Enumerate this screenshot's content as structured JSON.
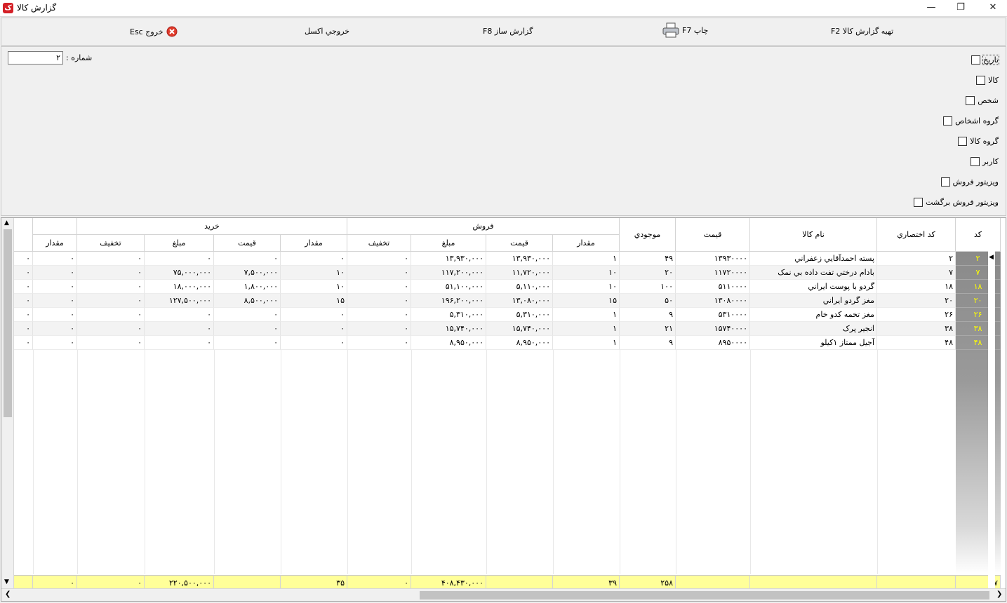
{
  "window": {
    "title": "گزارش کالا",
    "icon": "app-logo-icon",
    "app_letter": "ک"
  },
  "toolbar": {
    "prepare": "تهیه گزارش کالا F2",
    "print": "چاپ F7",
    "report_builder": "گزارش ساز F8",
    "excel": "خروجي اکسل",
    "exit": "خروج Esc"
  },
  "filters": {
    "items": [
      "تاریخ",
      "کالا",
      "شخص",
      "گروه اشخاص",
      "گروه کالا",
      "کاربر",
      "ویزیتور فروش",
      "ویزیتور فروش برگشت"
    ],
    "number_label": "شماره :",
    "number_value": "۲"
  },
  "grid": {
    "headers": {
      "code": "کد",
      "short_code": "کد اختصاري",
      "name": "نام کالا",
      "price": "قيمت",
      "stock": "موجودي",
      "sales": "فروش",
      "purchase": "خريد",
      "qty": "مقدار",
      "unit_price": "قيمت",
      "amount": "مبلغ",
      "discount": "تخفیف"
    },
    "rows": [
      {
        "code": "۲",
        "short": "۲",
        "name": "پسته احمدآقايي زعفراني",
        "price": "۱۳۹۳۰۰۰۰",
        "stock": "۴۹",
        "s_qty": "۱",
        "s_price": "۱۳,۹۳۰,۰۰۰",
        "s_amount": "۱۳,۹۳۰,۰۰۰",
        "s_disc": "۰",
        "p_qty": "۰",
        "p_price": "۰",
        "p_amount": "۰",
        "p_disc": "۰",
        "r_qty": "۰",
        "r_x": "۰"
      },
      {
        "code": "۷",
        "short": "۷",
        "name": "بادام درختي تفت داده بي نمک",
        "price": "۱۱۷۲۰۰۰۰",
        "stock": "۲۰",
        "s_qty": "۱۰",
        "s_price": "۱۱,۷۲۰,۰۰۰",
        "s_amount": "۱۱۷,۲۰۰,۰۰۰",
        "s_disc": "۰",
        "p_qty": "۱۰",
        "p_price": "۷,۵۰۰,۰۰۰",
        "p_amount": "۷۵,۰۰۰,۰۰۰",
        "p_disc": "۰",
        "r_qty": "۰",
        "r_x": "۰"
      },
      {
        "code": "۱۸",
        "short": "۱۸",
        "name": "گردو با پوست ايراني",
        "price": "۵۱۱۰۰۰۰",
        "stock": "۱۰۰",
        "s_qty": "۱۰",
        "s_price": "۵,۱۱۰,۰۰۰",
        "s_amount": "۵۱,۱۰۰,۰۰۰",
        "s_disc": "۰",
        "p_qty": "۱۰",
        "p_price": "۱,۸۰۰,۰۰۰",
        "p_amount": "۱۸,۰۰۰,۰۰۰",
        "p_disc": "۰",
        "r_qty": "۰",
        "r_x": "۰"
      },
      {
        "code": "۲۰",
        "short": "۲۰",
        "name": "مغز گردو ايراني",
        "price": "۱۳۰۸۰۰۰۰",
        "stock": "۵۰",
        "s_qty": "۱۵",
        "s_price": "۱۳,۰۸۰,۰۰۰",
        "s_amount": "۱۹۶,۲۰۰,۰۰۰",
        "s_disc": "۰",
        "p_qty": "۱۵",
        "p_price": "۸,۵۰۰,۰۰۰",
        "p_amount": "۱۲۷,۵۰۰,۰۰۰",
        "p_disc": "۰",
        "r_qty": "۰",
        "r_x": "۰"
      },
      {
        "code": "۲۶",
        "short": "۲۶",
        "name": "مغز تخمه کدو خام",
        "price": "۵۳۱۰۰۰۰",
        "stock": "۹",
        "s_qty": "۱",
        "s_price": "۵,۳۱۰,۰۰۰",
        "s_amount": "۵,۳۱۰,۰۰۰",
        "s_disc": "۰",
        "p_qty": "۰",
        "p_price": "۰",
        "p_amount": "۰",
        "p_disc": "۰",
        "r_qty": "۰",
        "r_x": "۰"
      },
      {
        "code": "۳۸",
        "short": "۳۸",
        "name": "انجير پرک",
        "price": "۱۵۷۴۰۰۰۰",
        "stock": "۲۱",
        "s_qty": "۱",
        "s_price": "۱۵,۷۴۰,۰۰۰",
        "s_amount": "۱۵,۷۴۰,۰۰۰",
        "s_disc": "۰",
        "p_qty": "۰",
        "p_price": "۰",
        "p_amount": "۰",
        "p_disc": "۰",
        "r_qty": "۰",
        "r_x": "۰"
      },
      {
        "code": "۴۸",
        "short": "۴۸",
        "name": "آجیل ممتاز ۱کیلو",
        "price": "۸۹۵۰۰۰۰",
        "stock": "۹",
        "s_qty": "۱",
        "s_price": "۸,۹۵۰,۰۰۰",
        "s_amount": "۸,۹۵۰,۰۰۰",
        "s_disc": "۰",
        "p_qty": "۰",
        "p_price": "۰",
        "p_amount": "۰",
        "p_disc": "۰",
        "r_qty": "۰",
        "r_x": "۰"
      }
    ],
    "footer": {
      "code": "۷",
      "stock": "۲۵۸",
      "s_qty": "۳۹",
      "s_amount": "۴۰۸,۴۳۰,۰۰۰",
      "s_disc": "۰",
      "p_qty": "۳۵",
      "p_amount": "۲۲۰,۵۰۰,۰۰۰",
      "p_disc": "۰",
      "r_qty": "۰"
    },
    "colors": {
      "code_text": "#ffff00",
      "footer_bg": "#ffff99"
    }
  }
}
